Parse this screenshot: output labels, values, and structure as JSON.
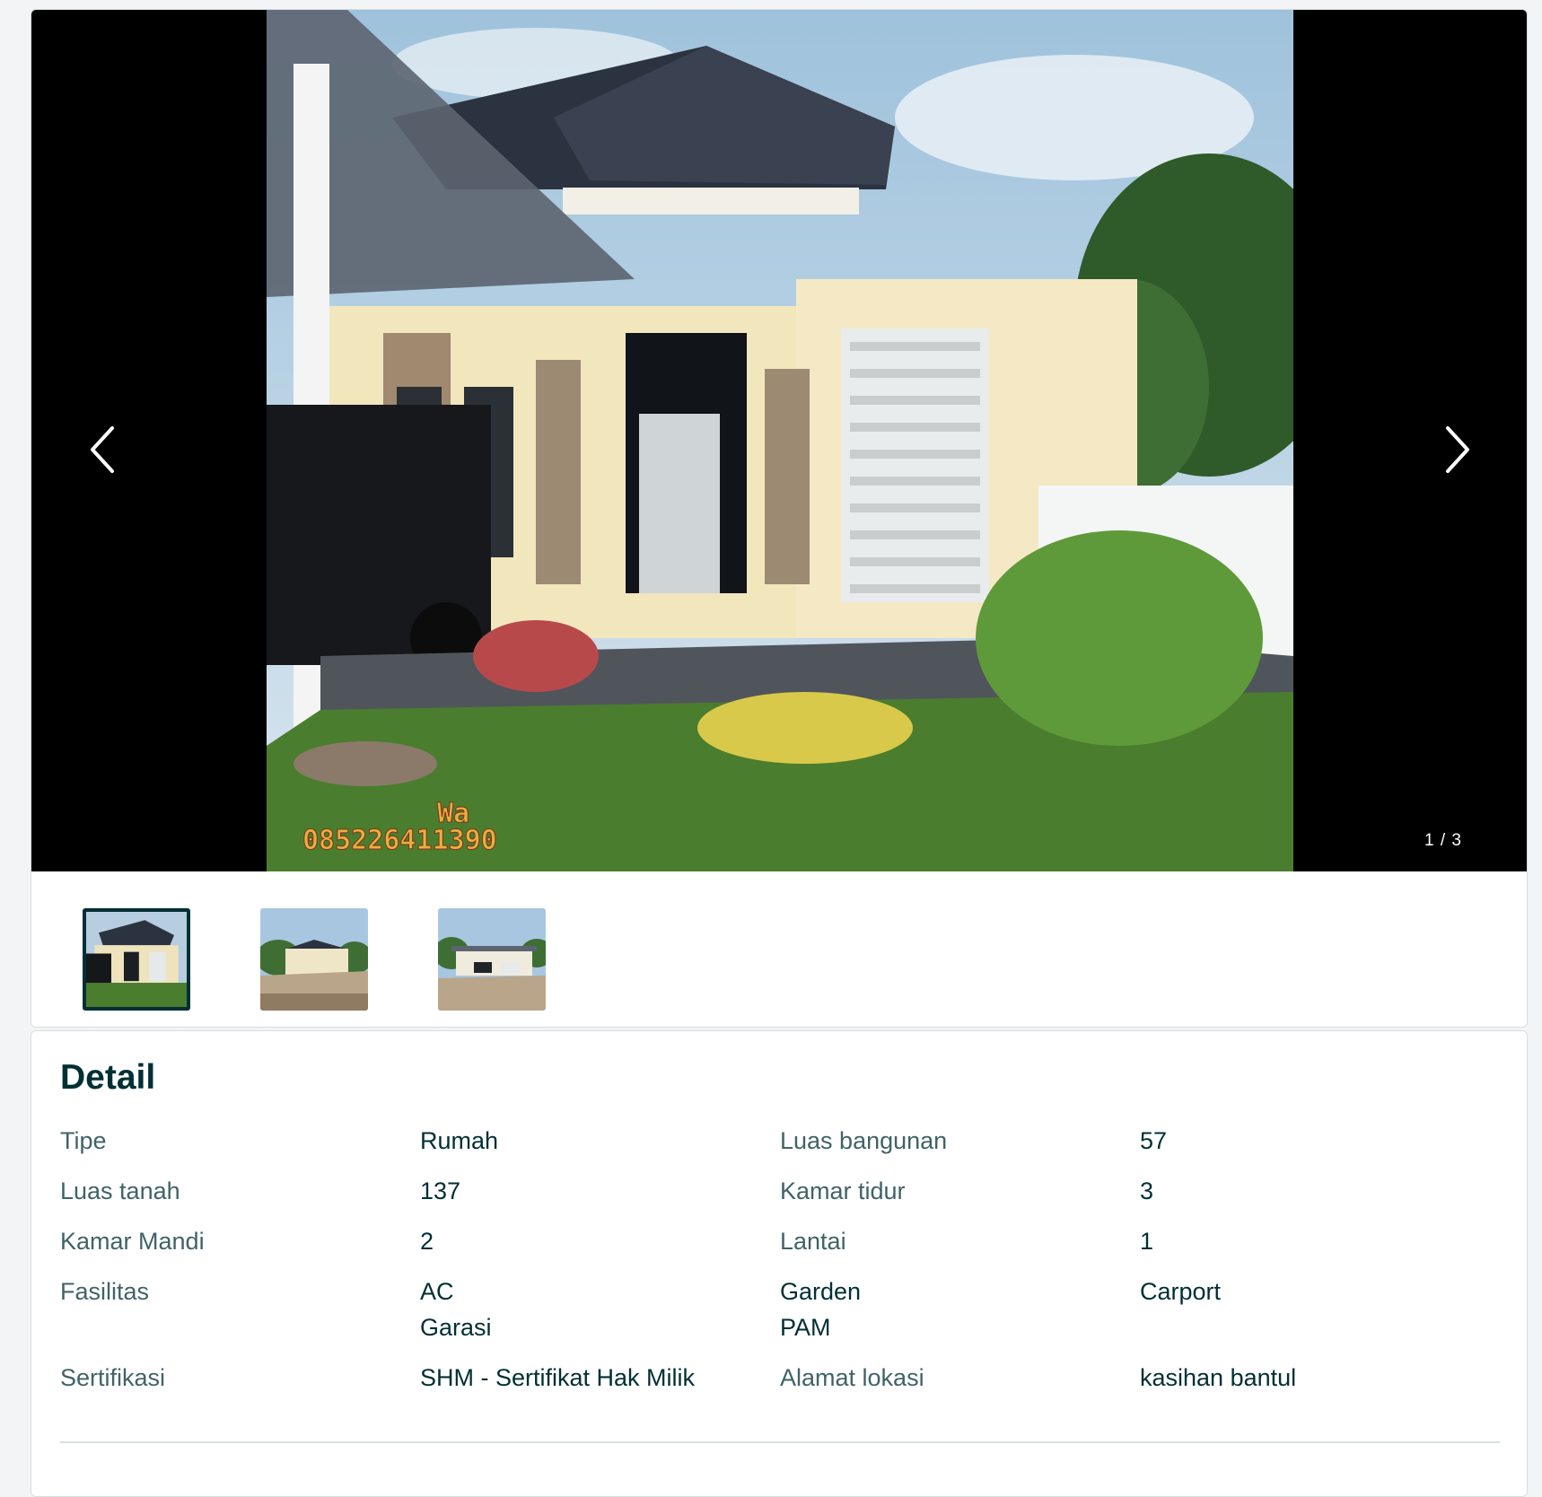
{
  "gallery": {
    "watermark_line1": "Wa",
    "watermark_line2": "085226411390",
    "counter": "1 / 3",
    "prev_icon": "chevron-left-icon",
    "next_icon": "chevron-right-icon",
    "thumbnail_count": 3,
    "active_thumbnail": 1
  },
  "detail": {
    "title": "Detail",
    "rows": [
      {
        "label1": "Tipe",
        "value1": "Rumah",
        "label2": "Luas bangunan",
        "value2": "57"
      },
      {
        "label1": "Luas tanah",
        "value1": "137",
        "label2": "Kamar tidur",
        "value2": "3"
      },
      {
        "label1": "Kamar Mandi",
        "value1": "2",
        "label2": "Lantai",
        "value2": "1"
      }
    ],
    "facilities": {
      "label": "Fasilitas",
      "items": [
        "AC",
        "Garden",
        "Carport",
        "Garasi",
        "PAM"
      ]
    },
    "certification": {
      "label1": "Sertifikasi",
      "value1": "SHM - Sertifikat Hak Milik",
      "label2": "Alamat lokasi",
      "value2": "kasihan bantul"
    }
  },
  "colors": {
    "text_primary": "#002f34",
    "text_label": "#406367",
    "border": "#d8dfe0",
    "viewer_background": "#000000"
  }
}
